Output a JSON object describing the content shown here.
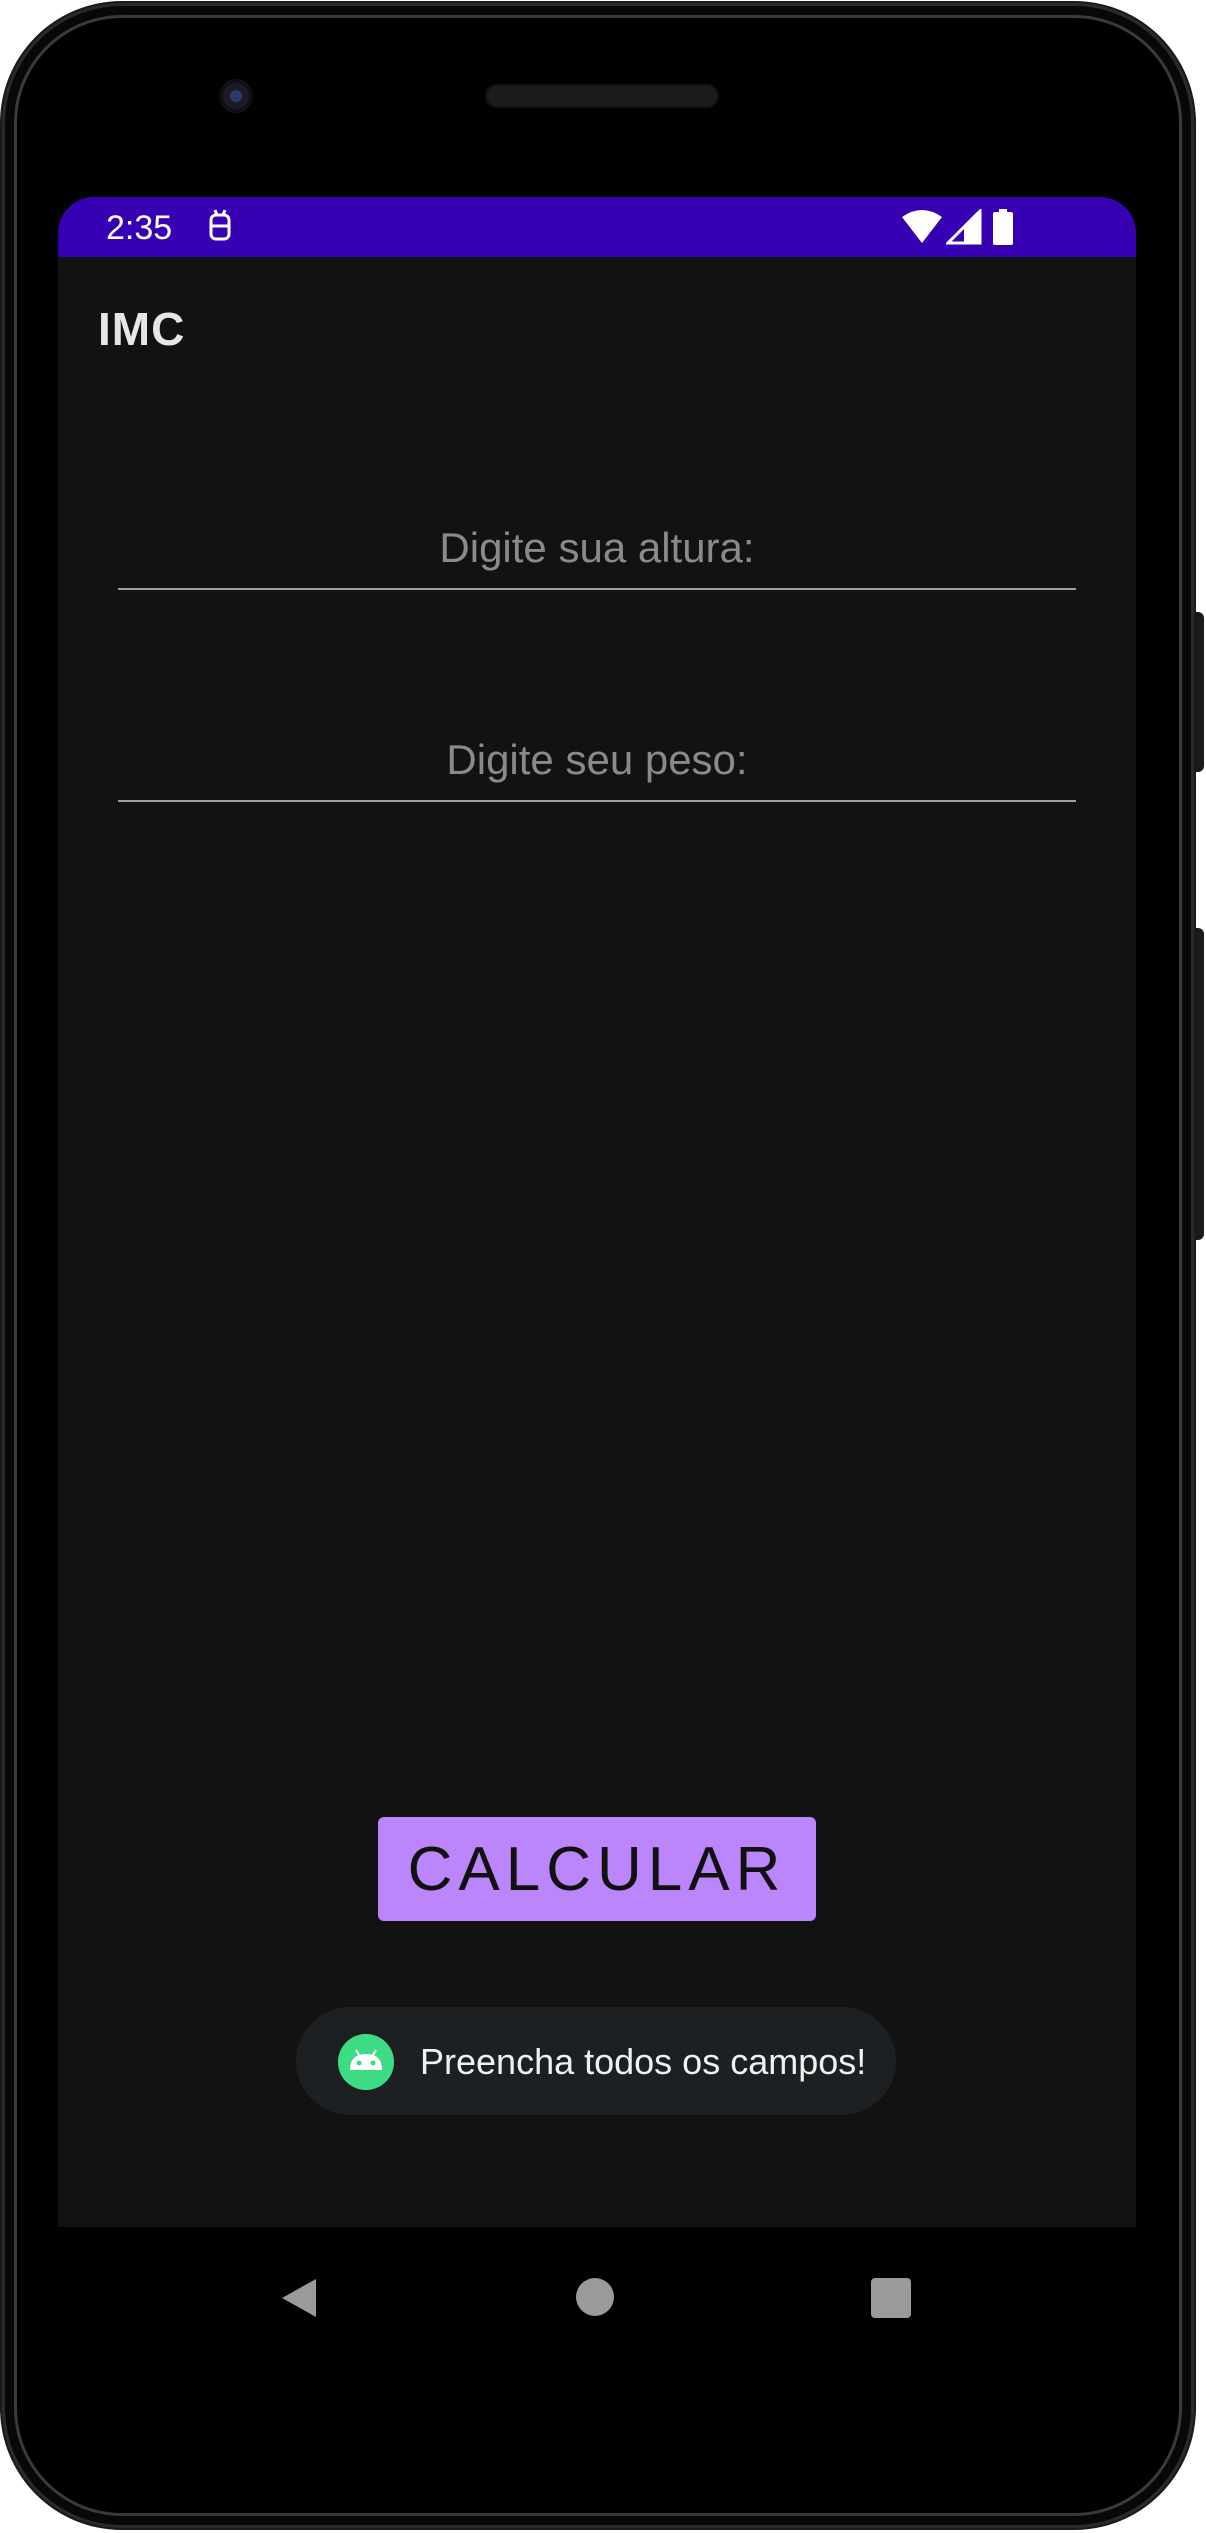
{
  "status_bar": {
    "time": "2:35",
    "notification_icon": "android-debug-icon",
    "icons": [
      "wifi-icon",
      "cell-signal-icon",
      "battery-icon"
    ],
    "color": "#3700b3"
  },
  "app_bar": {
    "title": "IMC"
  },
  "form": {
    "height_field": {
      "placeholder": "Digite sua altura:",
      "value": ""
    },
    "weight_field": {
      "placeholder": "Digite seu peso:",
      "value": ""
    },
    "calculate_label": "CALCULAR",
    "button_color": "#bb86fc"
  },
  "toast": {
    "icon": "android-icon",
    "message": "Preencha todos os campos!"
  },
  "nav_bar": {
    "buttons": [
      "back-icon",
      "home-icon",
      "recents-icon"
    ]
  }
}
